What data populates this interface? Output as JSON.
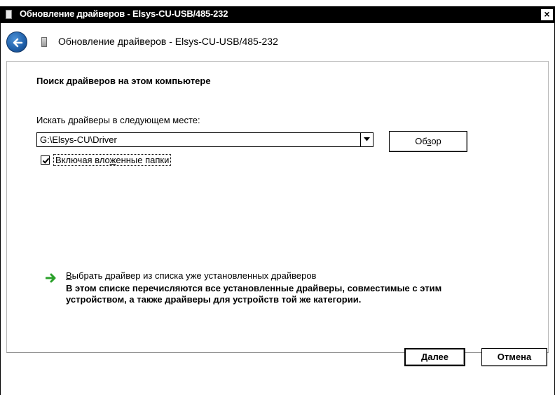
{
  "window": {
    "title": "Обновление драйверов - Elsys-CU-USB/485-232",
    "close_glyph": "×"
  },
  "header": {
    "title": "Обновление драйверов - Elsys-CU-USB/485-232"
  },
  "content": {
    "section_title": "Поиск драйверов на этом компьютере",
    "path_label": "Искать драйверы в следующем месте:",
    "path_value": "G:\\Elsys-CU\\Driver",
    "browse_label_pre": "Об",
    "browse_label_accel": "з",
    "browse_label_post": "ор",
    "include_subfolders_pre": "Включая вло",
    "include_subfolders_accel": "ж",
    "include_subfolders_post": "енные папки",
    "include_subfolders_checked": true,
    "pick_link_accel": "В",
    "pick_link_rest": "ыбрать драйвер из списка уже установленных драйверов",
    "pick_desc": "В этом списке перечисляются все установленные драйверы, совместимые с этим устройством, а также драйверы для устройств той же категории."
  },
  "footer": {
    "next_accel": "Д",
    "next_rest": "алее",
    "cancel_label": "Отмена"
  },
  "colors": {
    "titlebar_bg": "#000000",
    "link_arrow": "#2aa02a",
    "back_button": "#1f5fa8"
  },
  "icons": {
    "back": "back-arrow-icon",
    "device": "usb-device-icon",
    "link": "green-arrow-icon"
  }
}
